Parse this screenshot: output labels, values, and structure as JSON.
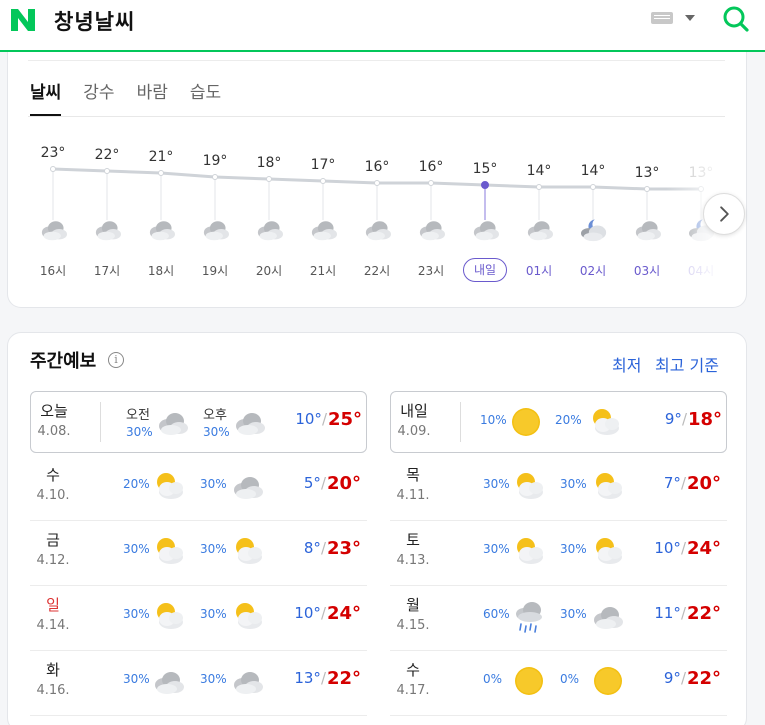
{
  "header": {
    "title": "창녕날씨",
    "logo_letter": "N"
  },
  "tabs": [
    {
      "label": "날씨",
      "active": true
    },
    {
      "label": "강수",
      "active": false
    },
    {
      "label": "바람",
      "active": false
    },
    {
      "label": "습도",
      "active": false
    }
  ],
  "hourly": [
    {
      "temp": "23°",
      "time": "16시",
      "icon": "cloudy-icon"
    },
    {
      "temp": "22°",
      "time": "17시",
      "icon": "cloudy-icon"
    },
    {
      "temp": "21°",
      "time": "18시",
      "icon": "cloudy-icon"
    },
    {
      "temp": "19°",
      "time": "19시",
      "icon": "cloudy-icon"
    },
    {
      "temp": "18°",
      "time": "20시",
      "icon": "cloudy-icon"
    },
    {
      "temp": "17°",
      "time": "21시",
      "icon": "cloudy-icon"
    },
    {
      "temp": "16°",
      "time": "22시",
      "icon": "cloudy-icon"
    },
    {
      "temp": "16°",
      "time": "23시",
      "icon": "cloudy-icon"
    },
    {
      "temp": "15°",
      "time": "내일",
      "icon": "cloudy-icon"
    },
    {
      "temp": "14°",
      "time": "01시",
      "icon": "cloudy-icon"
    },
    {
      "temp": "14°",
      "time": "02시",
      "icon": "cloudy-night-icon"
    },
    {
      "temp": "13°",
      "time": "03시",
      "icon": "cloudy-icon"
    },
    {
      "temp": "13°",
      "time": "04시",
      "icon": "cloudy-night-icon"
    }
  ],
  "weekly": {
    "title": "주간예보",
    "sort_low": "최저",
    "sort_high": "최고 기준",
    "am_label": "오전",
    "pm_label": "오후",
    "days": [
      {
        "day": "오늘",
        "date": "4.08.",
        "am_rain": "30%",
        "pm_rain": "30%",
        "am_icon": "cloudy-icon",
        "pm_icon": "cloudy-icon",
        "low": "10°",
        "high": "25°",
        "boxed": true,
        "labels": true
      },
      {
        "day": "내일",
        "date": "4.09.",
        "am_rain": "10%",
        "pm_rain": "20%",
        "am_icon": "sunny-icon",
        "pm_icon": "partly-cloudy-icon",
        "low": "9°",
        "high": "18°",
        "boxed": true,
        "labels": false
      },
      {
        "day": "수",
        "date": "4.10.",
        "am_rain": "20%",
        "pm_rain": "30%",
        "am_icon": "partly-cloudy-icon",
        "pm_icon": "cloudy-icon",
        "low": "5°",
        "high": "20°"
      },
      {
        "day": "목",
        "date": "4.11.",
        "am_rain": "30%",
        "pm_rain": "30%",
        "am_icon": "partly-cloudy-icon",
        "pm_icon": "partly-cloudy-icon",
        "low": "7°",
        "high": "20°"
      },
      {
        "day": "금",
        "date": "4.12.",
        "am_rain": "30%",
        "pm_rain": "30%",
        "am_icon": "partly-cloudy-icon",
        "pm_icon": "partly-cloudy-icon",
        "low": "8°",
        "high": "23°"
      },
      {
        "day": "토",
        "date": "4.13.",
        "am_rain": "30%",
        "pm_rain": "30%",
        "am_icon": "partly-cloudy-icon",
        "pm_icon": "partly-cloudy-icon",
        "low": "10°",
        "high": "24°"
      },
      {
        "day": "일",
        "date": "4.14.",
        "am_rain": "30%",
        "pm_rain": "30%",
        "am_icon": "partly-cloudy-icon",
        "pm_icon": "partly-cloudy-icon",
        "low": "10°",
        "high": "24°",
        "sunday": true
      },
      {
        "day": "월",
        "date": "4.15.",
        "am_rain": "60%",
        "pm_rain": "30%",
        "am_icon": "rain-icon",
        "pm_icon": "cloudy-icon",
        "low": "11°",
        "high": "22°"
      },
      {
        "day": "화",
        "date": "4.16.",
        "am_rain": "30%",
        "pm_rain": "30%",
        "am_icon": "cloudy-icon",
        "pm_icon": "cloudy-icon",
        "low": "13°",
        "high": "22°"
      },
      {
        "day": "수",
        "date": "4.17.",
        "am_rain": "0%",
        "pm_rain": "0%",
        "am_icon": "sunny-icon",
        "pm_icon": "sunny-icon",
        "low": "9°",
        "high": "22°"
      }
    ]
  },
  "colors": {
    "brand": "#03c75a",
    "high": "#d40000",
    "low": "#2b63d9",
    "rain": "#3a7be0",
    "accent": "#6a5acd"
  }
}
